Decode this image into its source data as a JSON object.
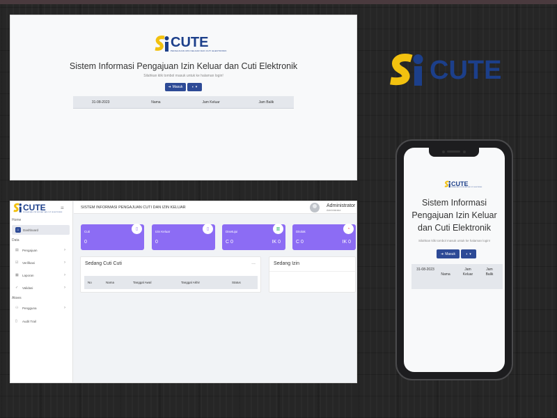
{
  "brand": {
    "logo_text": "CUTE",
    "logo_subtitle": "PENGAJUAN IZIN KELUAR DAN CUTI ELEKTRONIK",
    "colors": {
      "blue": "#1c3f8a",
      "yellow": "#f2c10f",
      "purple": "#8c6cf4",
      "button": "#2d4a96"
    }
  },
  "login": {
    "title": "Sistem Informasi Pengajuan Izin Keluar dan Cuti Elektronik",
    "subtitle": "Silahkan klik tombol masuk untuk ke halaman login!",
    "login_button": "Masuk",
    "login_icon": "sign-in-icon",
    "theme_icon": "theme-toggle-icon",
    "dropdown_icon": "caret-down-icon",
    "table": {
      "date": "31-08-2023",
      "columns": [
        "Nama",
        "Jam Keluar",
        "Jam Balik"
      ]
    }
  },
  "dashboard": {
    "app_title": "SISTEM INFORMASI PENGAJUAN CUTI DAN IZIN KELUAR",
    "user": {
      "name": "Administrator",
      "role": "Administrator"
    },
    "sidebar": {
      "sections": {
        "home": "Home",
        "data": "Data",
        "akses": "Akses"
      },
      "items": [
        {
          "label": "Dashboard",
          "icon": "home-icon",
          "active": true
        },
        {
          "label": "Pengajuan",
          "icon": "file-icon"
        },
        {
          "label": "Verifikasi",
          "icon": "check-icon"
        },
        {
          "label": "Laporan",
          "icon": "report-icon"
        },
        {
          "label": "Validasi",
          "icon": "validate-icon"
        },
        {
          "label": "Pengguna",
          "icon": "users-icon"
        },
        {
          "label": "Audit Trail",
          "icon": "audit-icon"
        }
      ]
    },
    "cards": [
      {
        "label": "Cuti",
        "value": "0",
        "icon": "document-icon"
      },
      {
        "label": "Izin Keluar",
        "value": "0",
        "icon": "document-icon"
      },
      {
        "label": "Disetujui",
        "value": "C 0",
        "value2": "IK 0",
        "icon": "chart-icon"
      },
      {
        "label": "Ditolak",
        "value": "C 0",
        "value2": "IK 0",
        "icon": "pie-icon"
      }
    ],
    "panel_cuti": {
      "title": "Sedang Cuti Cuti",
      "more": "...",
      "columns": [
        "No",
        "Nama",
        "Tanggal Awal",
        "Tanggal Akhir",
        "Status"
      ]
    },
    "panel_izin": {
      "title": "Sedang Izin"
    }
  },
  "mobile": {
    "title": "Sistem Informasi Pengajuan Izin Keluar dan Cuti Elektronik",
    "subtitle": "Silahkan klik tombol masuk untuk ke halaman login!",
    "login_button": "Masuk",
    "table": {
      "date": "31-08-2023",
      "nama": "Nama",
      "jam_keluar": "Jam Keluar",
      "jam_balik": "Jam Balik"
    }
  }
}
